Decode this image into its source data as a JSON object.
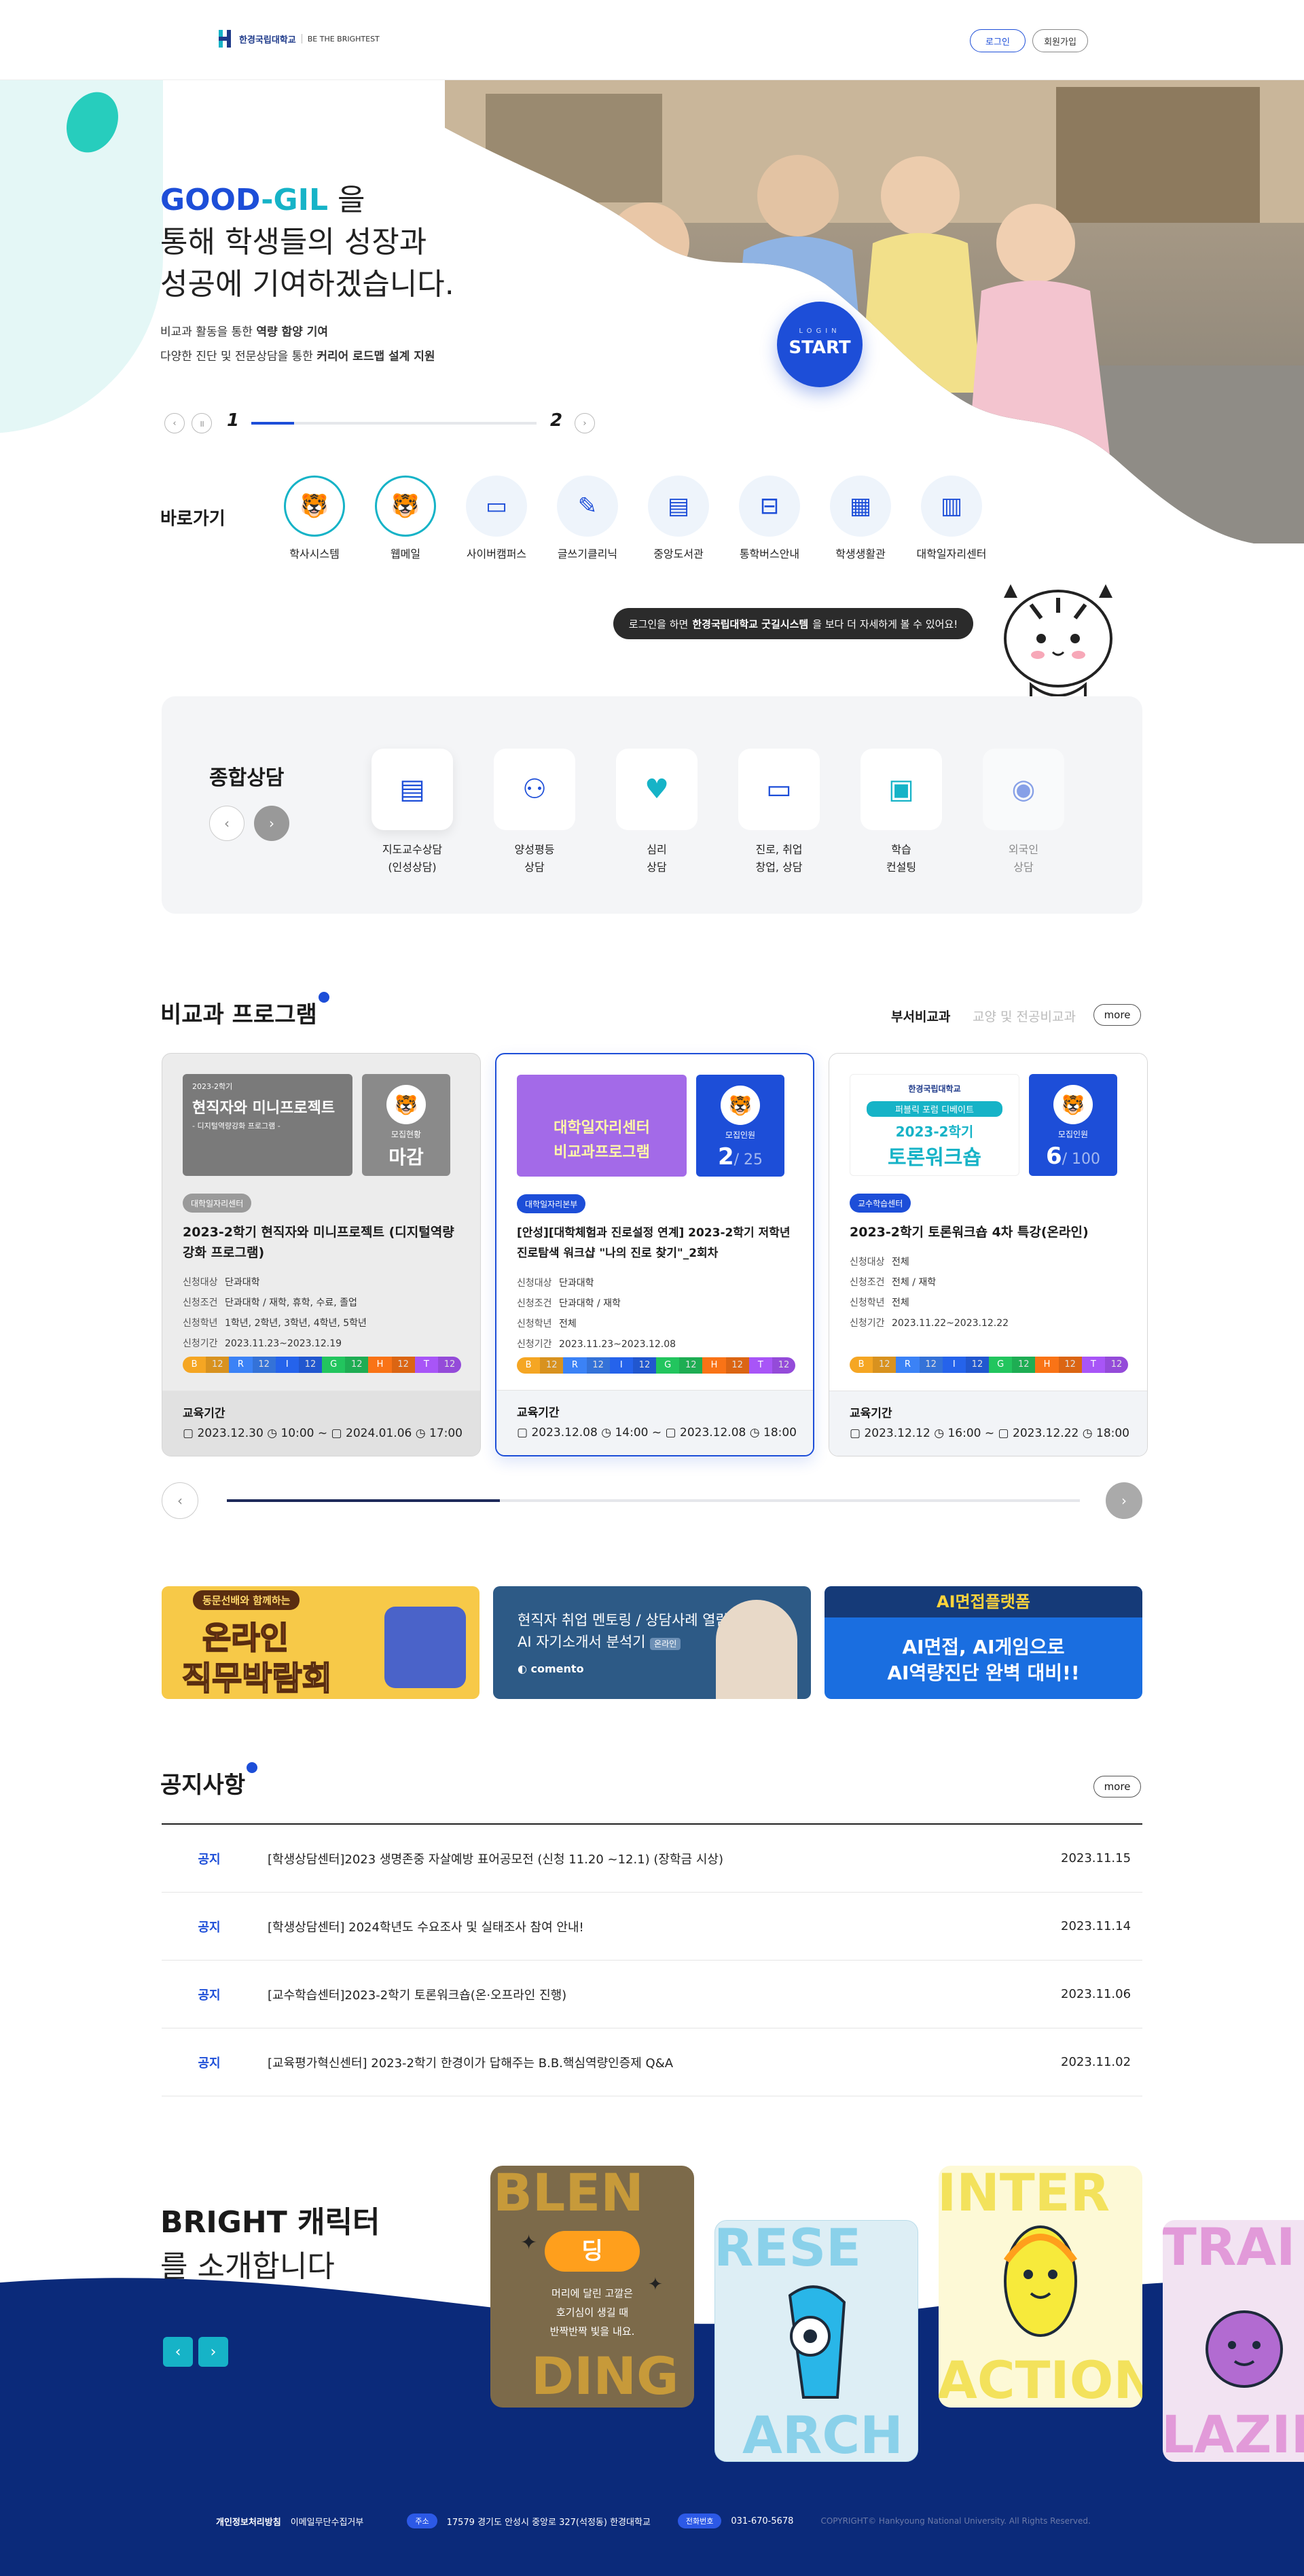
{
  "header": {
    "logo_name": "한경국립대학교",
    "logo_slogan": "BE THE BRIGHTEST",
    "login_label": "로그인",
    "join_label": "회원가입"
  },
  "hero": {
    "title_part1": "GOOD",
    "title_part2": "-GIL",
    "title_line1_rest": " 을",
    "title_line2": "통해 학생들의 성장과",
    "title_line3": "성공에 기여하겠습니다.",
    "sub1_pre": "비교과 활동을 통한 ",
    "sub1_bold": "역량 함양 기여",
    "sub2_pre": "다양한 진단 및 전문상담을 통한 ",
    "sub2_bold": "커리어 로드맵 설계 지원",
    "start_small": "LOGIN",
    "start_label": "START",
    "slide_current": "1",
    "slide_total": "2",
    "slide_progress": 0.5
  },
  "quick": {
    "title": "바로가기",
    "items": [
      {
        "label": "학사시스템",
        "icon": "tiger-mascot-icon"
      },
      {
        "label": "웹메일",
        "icon": "tiger-mascot-icon"
      },
      {
        "label": "사이버캠퍼스",
        "icon": "laptop-icon"
      },
      {
        "label": "글쓰기클리닉",
        "icon": "pencil-icon"
      },
      {
        "label": "중앙도서관",
        "icon": "book-icon"
      },
      {
        "label": "통학버스안내",
        "icon": "bus-icon"
      },
      {
        "label": "학생생활관",
        "icon": "document-icon"
      },
      {
        "label": "대학일자리센터",
        "icon": "building-icon"
      }
    ]
  },
  "bubble": {
    "pre": "로그인을 하면",
    "bold": "한경국립대학교 굿길시스템",
    "post": "을 보다 더 자세하게 볼 수 있어요!"
  },
  "counseling": {
    "title": "종합상담",
    "items": [
      {
        "label": "지도교수상담\n(인성상담)",
        "icon": "clipboard-icon"
      },
      {
        "label": "양성평등\n상담",
        "icon": "people-icon"
      },
      {
        "label": "심리\n상담",
        "icon": "heart-hands-icon"
      },
      {
        "label": "진로, 취업\n창업, 상담",
        "icon": "chat-icon"
      },
      {
        "label": "학습\n컨설팅",
        "icon": "open-book-icon"
      },
      {
        "label": "외국인\n상담",
        "icon": "globe-hand-icon"
      }
    ]
  },
  "programs": {
    "title": "비교과 프로그램",
    "tabs": [
      "부서비교과",
      "교양 및 전공비교과"
    ],
    "more": "more",
    "tags": [
      {
        "k": "B",
        "v": "12"
      },
      {
        "k": "R",
        "v": "12"
      },
      {
        "k": "I",
        "v": "12"
      },
      {
        "k": "G",
        "v": "12"
      },
      {
        "k": "H",
        "v": "12"
      },
      {
        "k": "T",
        "v": "12"
      }
    ],
    "period_label": "교육기간",
    "labels": [
      "신청대상",
      "신청조건",
      "신청학년",
      "신청기간"
    ],
    "cards": [
      {
        "thumb_line1": "2023-2학기",
        "thumb_line2": "현직자와 미니프로젝트",
        "thumb_line3": "- 디지털역량강화 프로그램 -",
        "status_label": "모집현황",
        "status_value": "마감",
        "org": "대학일자리센터",
        "title": "2023-2학기 현직자와 미니프로젝트 (디지털역량강화 프로그램)",
        "target": "단과대학",
        "cond": "단과대학 / 재학, 휴학, 수료, 졸업",
        "grade": "1학년, 2학년, 3학년, 4학년, 5학년",
        "apply": "2023.11.23~2023.12.19",
        "period": "2023.12.30 ⓘ 10:00 ~ 2024.01.06 ⓘ 17:00",
        "p_start": "2023.12.30",
        "p_st": "10:00",
        "p_end": "2024.01.06",
        "p_et": "17:00"
      },
      {
        "thumb_line1": "대학일자리센터",
        "thumb_line2": "비교과프로그램",
        "status_label": "모집인원",
        "status_value": "2",
        "status_total": "/ 25",
        "org": "대학일자리본부",
        "title": "[안성][대학체험과 진로설정 연계] 2023-2학기 저학년 진로탐색 워크샵 \"나의 진로 찾기\"_2회차",
        "target": "단과대학",
        "cond": "단과대학 / 재학",
        "grade": "전체",
        "apply": "2023.11.23~2023.12.08",
        "p_start": "2023.12.08",
        "p_st": "14:00",
        "p_end": "2023.12.08",
        "p_et": "18:00"
      },
      {
        "thumb_line0": "한경국립대학교",
        "thumb_line1": "퍼블릭 포럼 디베이트",
        "thumb_line2": "2023-2학기",
        "thumb_line3": "토론워크숍",
        "status_label": "모집인원",
        "status_value": "6",
        "status_total": "/ 100",
        "org": "교수학습센터",
        "title": "2023-2학기 토론워크숍 4차 특강(온라인)",
        "target": "전체",
        "cond": "전체 / 재학",
        "grade": "전체",
        "apply": "2023.11.22~2023.12.22",
        "p_start": "2023.12.12",
        "p_st": "16:00",
        "p_end": "2023.12.22",
        "p_et": "18:00"
      }
    ],
    "scroll_progress": 0.32
  },
  "banners": [
    {
      "l1": "동문선배와 함께하는",
      "l2": "온라인",
      "l3": "직무박람회"
    },
    {
      "l1": "현직자 취업 멘토링 / 상담사례 열람",
      "l2": "AI 자기소개서 분석기",
      "tag": "온라인",
      "brand": "comento"
    },
    {
      "l1": "AI면접플랫폼",
      "l2": "AI면접, AI게임으로",
      "l3": "AI역량진단 완벽 대비!!"
    }
  ],
  "notices": {
    "title": "공지사항",
    "more": "more",
    "rows": [
      {
        "kind": "공지",
        "subject": "[학생상담센터]2023 생명존중 자살예방 표어공모전 (신청 11.20 ~12.1) (장학금 시상)",
        "date": "2023.11.15"
      },
      {
        "kind": "공지",
        "subject": "[학생상담센터] 2024학년도 수요조사 및 실태조사 참여 안내!",
        "date": "2023.11.14"
      },
      {
        "kind": "공지",
        "subject": "[교수학습센터]2023-2학기 토론워크숍(온·오프라인 진행)",
        "date": "2023.11.06"
      },
      {
        "kind": "공지",
        "subject": "[교육평가혁신센터] 2023-2학기 한경이가 답해주는 B.B.핵심역량인증제 Q&A",
        "date": "2023.11.02"
      }
    ]
  },
  "characters": {
    "title1": "BRIGHT 캐릭터",
    "title2": "를 소개합니다",
    "cards": [
      {
        "top": "BLEN",
        "bottom": "DING",
        "name": "딩",
        "desc": "머리에 달린 고깔은\n호기심이 생길 때\n반짝반짝 빛을 내요."
      },
      {
        "top": "RESE",
        "bottom": "ARCH"
      },
      {
        "top": "INTER",
        "bottom": "ACTION"
      },
      {
        "top": "TRAI",
        "bottom": "LAZIN"
      }
    ]
  },
  "footer": {
    "privacy": "개인정보처리방침",
    "email_policy": "이메일무단수집거부",
    "addr_label": "주소",
    "addr": "17579 경기도 안성시 중앙로 327(석정동) 한경대학교",
    "tel_label": "전화번호",
    "tel": "031-670-5678",
    "copy": "COPYRIGHT© Hankyoung National University. All Rights Reserved."
  },
  "colors": {
    "primary": "#1d4ed8",
    "teal": "#16b3c7",
    "navy": "#0b2a7a"
  }
}
